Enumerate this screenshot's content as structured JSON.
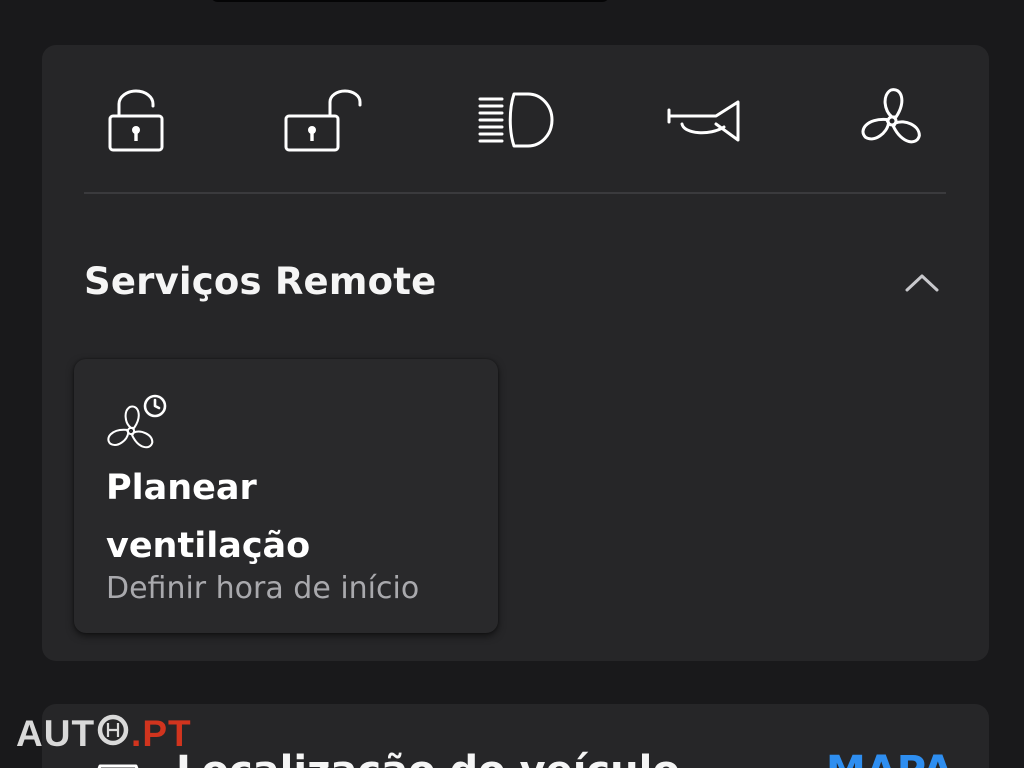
{
  "quick_actions": [
    {
      "name": "lock-icon",
      "label": ""
    },
    {
      "name": "unlock-icon",
      "label": ""
    },
    {
      "name": "headlight-icon",
      "label": ""
    },
    {
      "name": "horn-icon",
      "label": ""
    },
    {
      "name": "fan-icon",
      "label": ""
    }
  ],
  "section": {
    "title": "Serviços Remote",
    "toggle_icon": "chevron-up-icon"
  },
  "services": [
    {
      "icon": "fan-clock-icon",
      "title": "Planear ventilação",
      "subtitle": "Definir hora de início"
    }
  ],
  "location_card": {
    "icon": "car-icon",
    "title": "Localização do veículo",
    "link": "MAPA"
  },
  "watermark": {
    "brand": "AUTO",
    "suffix": ".PT"
  },
  "colors": {
    "background": "#19191b",
    "card": "#262628",
    "accent": "#2e8ef0",
    "watermark_accent": "#d1341e"
  }
}
